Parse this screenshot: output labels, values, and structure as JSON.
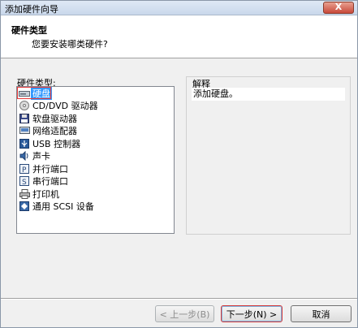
{
  "window": {
    "title": "添加硬件向导",
    "close_label": "X"
  },
  "header": {
    "title": "硬件类型",
    "subtitle": "您要安装哪类硬件?"
  },
  "list": {
    "label": "硬件类型:",
    "items": [
      {
        "label": "硬盘",
        "icon": "hard-disk-icon"
      },
      {
        "label": "CD/DVD 驱动器",
        "icon": "cd-dvd-icon"
      },
      {
        "label": "软盘驱动器",
        "icon": "floppy-icon"
      },
      {
        "label": "网络适配器",
        "icon": "network-adapter-icon"
      },
      {
        "label": "USB 控制器",
        "icon": "usb-icon"
      },
      {
        "label": "声卡",
        "icon": "sound-card-icon"
      },
      {
        "label": "并行端口",
        "icon": "parallel-port-icon"
      },
      {
        "label": "串行端口",
        "icon": "serial-port-icon"
      },
      {
        "label": "打印机",
        "icon": "printer-icon"
      },
      {
        "label": "通用 SCSI 设备",
        "icon": "scsi-icon"
      }
    ]
  },
  "explain": {
    "title": "解释",
    "text": "添加硬盘。"
  },
  "buttons": {
    "back": "< 上一步(B)",
    "next": "下一步(N) >",
    "cancel": "取消"
  },
  "colors": {
    "selection": "#3399ff",
    "highlight_box": "#e83a3a"
  }
}
